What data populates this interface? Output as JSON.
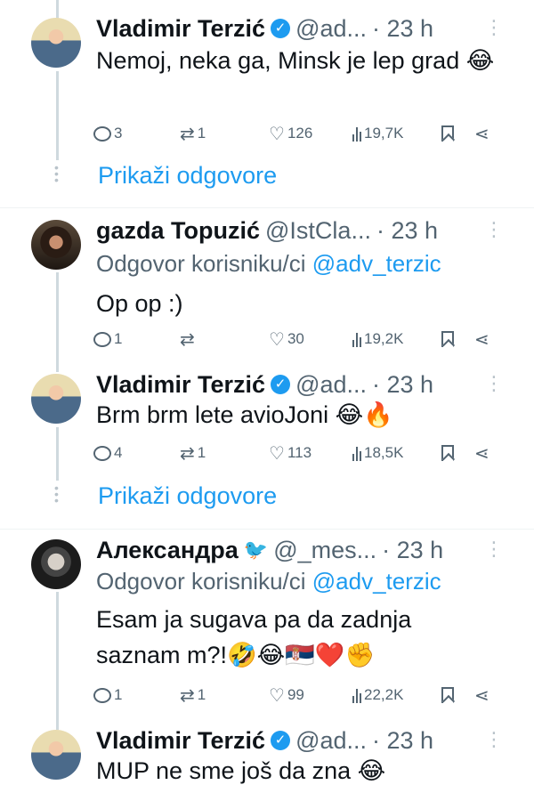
{
  "tweets": [
    {
      "name": "Vladimir Terzić",
      "handle": "@ad...",
      "time": "· 23 h",
      "reply_label": "",
      "reply_to": "",
      "text": "Nemoj, neka ga, Minsk je lep grad 😂",
      "replies": "3",
      "retweets": "1",
      "likes": "126",
      "views": "19,7K"
    },
    {
      "name": "gazda Topuzić",
      "handle": "@IstCla...",
      "time": "· 23 h",
      "reply_label": "Odgovor korisniku/ci",
      "reply_to": "@adv_terzic",
      "text": "Op op :)",
      "replies": "1",
      "retweets": "",
      "likes": "30",
      "views": "19,2K"
    },
    {
      "name": "Vladimir Terzić",
      "handle": "@ad...",
      "time": "· 23 h",
      "reply_label": "",
      "reply_to": "",
      "text": "Brm brm lete avioJoni 😂🔥",
      "replies": "4",
      "retweets": "1",
      "likes": "113",
      "views": "18,5K"
    },
    {
      "name": "Александра",
      "handle": "@_mes...",
      "time": "· 23 h",
      "reply_label": "Odgovor korisniku/ci",
      "reply_to": "@adv_terzic",
      "text": "Esam ja sugava pa da zadnja saznam m?!🤣😂🇷🇸❤️✊",
      "replies": "1",
      "retweets": "1",
      "likes": "99",
      "views": "22,2K"
    },
    {
      "name": "Vladimir Terzić",
      "handle": "@ad...",
      "time": "· 23 h",
      "reply_label": "",
      "reply_to": "",
      "text": "MUP ne sme još da zna 😂"
    }
  ],
  "show_replies_label": "Prikaži odgovore",
  "icons": [
    "verified-badge-icon",
    "twitter-bird-icon",
    "reply-icon",
    "retweet-icon",
    "like-icon",
    "views-icon",
    "bookmark-icon",
    "share-icon",
    "more-icon"
  ],
  "colors": {
    "accent": "#1d9bf0",
    "muted": "#536471",
    "thread": "#cfd9de"
  }
}
